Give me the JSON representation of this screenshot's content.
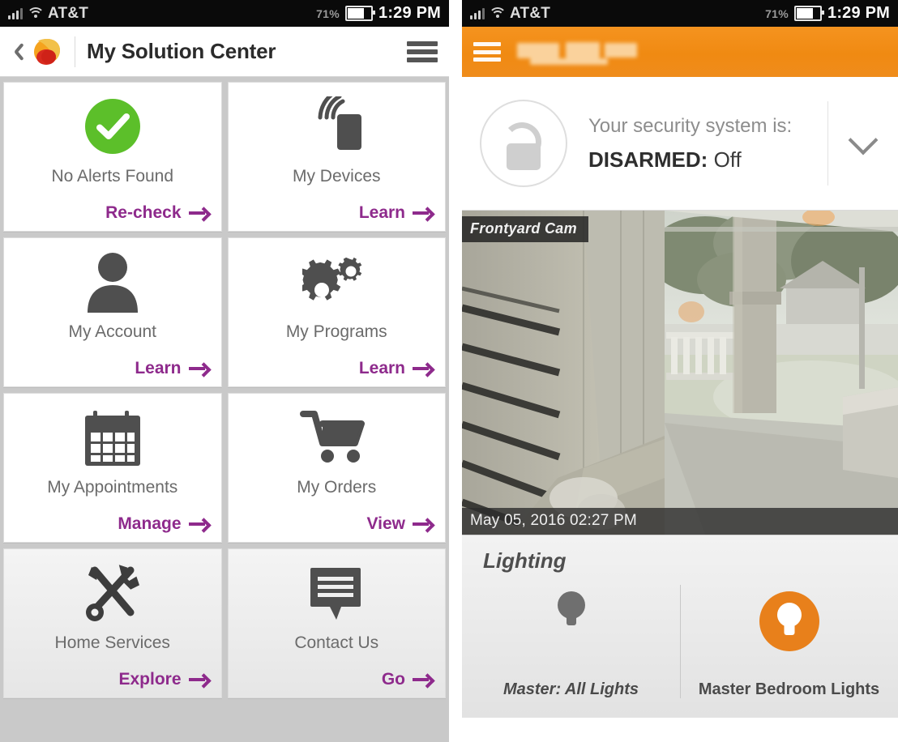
{
  "statusbar": {
    "carrier": "AT&T",
    "battery_pct": "71%",
    "time": "1:29 PM"
  },
  "left_phone": {
    "header": {
      "title": "My Solution Center",
      "back_icon": "back-chevron-icon",
      "logo_icon": "brand-logo-icon",
      "menu_icon": "hamburger-menu-icon"
    },
    "tiles": [
      {
        "label": "No Alerts Found",
        "link": "Re-check",
        "icon": "green-check-circle-icon",
        "shaded": false
      },
      {
        "label": "My Devices",
        "link": "Learn",
        "icon": "wireless-device-icon",
        "shaded": false
      },
      {
        "label": "My Account",
        "link": "Learn",
        "icon": "person-icon",
        "shaded": false
      },
      {
        "label": "My Programs",
        "link": "Learn",
        "icon": "gears-icon",
        "shaded": false
      },
      {
        "label": "My Appointments",
        "link": "Manage",
        "icon": "calendar-icon",
        "shaded": false
      },
      {
        "label": "My Orders",
        "link": "View",
        "icon": "shopping-cart-icon",
        "shaded": false
      },
      {
        "label": "Home Services",
        "link": "Explore",
        "icon": "tools-icon",
        "shaded": true
      },
      {
        "label": "Contact Us",
        "link": "Go",
        "icon": "chat-bubble-icon",
        "shaded": true
      }
    ]
  },
  "right_phone": {
    "header": {
      "menu_icon": "hamburger-menu-icon",
      "logo_icon": "blurred-brand-logo"
    },
    "security": {
      "caption": "Your security system is:",
      "state": "DISARMED:",
      "state_detail": " Off",
      "lock_icon": "unlocked-padlock-icon",
      "expand_icon": "chevron-down-icon"
    },
    "camera": {
      "name": "Frontyard Cam",
      "timestamp": "May 05, 2016 02:27 PM"
    },
    "lighting": {
      "title": "Lighting",
      "items": [
        {
          "label": "Master: All Lights",
          "state": "off",
          "icon": "light-bulb-off-icon"
        },
        {
          "label": "Master Bedroom Lights",
          "state": "on",
          "icon": "light-bulb-on-icon"
        }
      ]
    }
  },
  "colors": {
    "accent_purple": "#8e2a8c",
    "brand_orange": "#f08a12",
    "status_green": "#5cbf2a",
    "icon_gray": "#4f4f4f"
  }
}
